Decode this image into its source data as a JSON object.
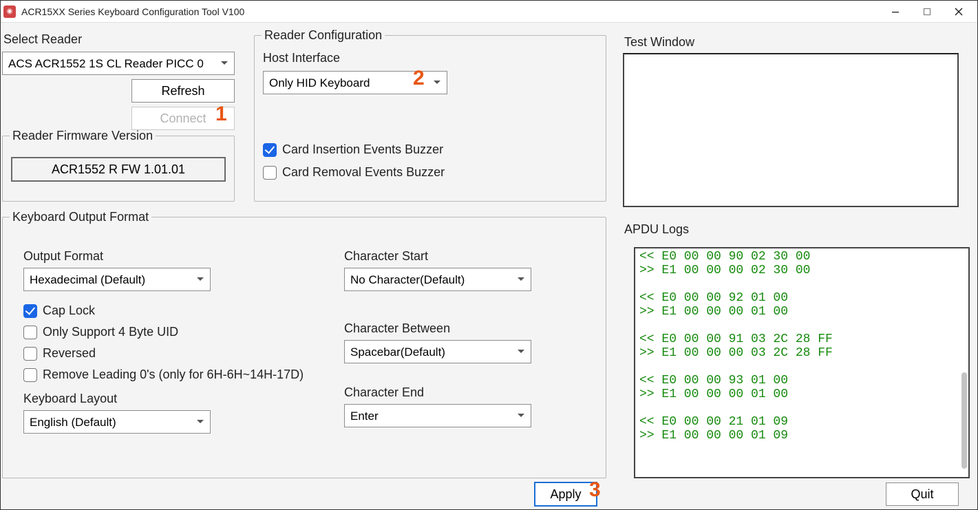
{
  "window": {
    "title": "ACR15XX Series Keyboard Configuration Tool V100"
  },
  "selectReader": {
    "label": "Select Reader",
    "value": "ACS ACR1552 1S CL Reader PICC 0",
    "refresh": "Refresh",
    "connect": "Connect"
  },
  "firmware": {
    "legend": "Reader Firmware Version",
    "value": "ACR1552 R FW 1.01.01"
  },
  "readerConfig": {
    "legend": "Reader Configuration",
    "hostInterfaceLabel": "Host Interface",
    "hostInterfaceValue": "Only HID Keyboard",
    "cardInsertion": "Card Insertion Events Buzzer",
    "cardRemoval": "Card Removal Events Buzzer"
  },
  "kof": {
    "legend": "Keyboard Output Format",
    "outputFormatLabel": "Output Format",
    "outputFormatValue": "Hexadecimal (Default)",
    "capLock": "Cap Lock",
    "only4byte": "Only Support 4 Byte UID",
    "reversed": "Reversed",
    "removeLeading": "Remove Leading 0's (only for 6H-6H~14H-17D)",
    "keyboardLayoutLabel": "Keyboard Layout",
    "keyboardLayoutValue": "English (Default)",
    "charStartLabel": "Character Start",
    "charStartValue": "No Character(Default)",
    "charBetweenLabel": "Character Between",
    "charBetweenValue": "Spacebar(Default)",
    "charEndLabel": "Character End",
    "charEndValue": "Enter"
  },
  "buttons": {
    "apply": "Apply",
    "quit": "Quit"
  },
  "testWindow": {
    "label": "Test Window",
    "value": ""
  },
  "apduLogs": {
    "label": "APDU Logs",
    "lines": [
      "<< E0 00 00 90 02 30 00",
      ">> E1 00 00 00 02 30 00",
      "",
      "<< E0 00 00 92 01 00",
      ">> E1 00 00 00 01 00",
      "",
      "<< E0 00 00 91 03 2C 28 FF",
      ">> E1 00 00 00 03 2C 28 FF",
      "",
      "<< E0 00 00 93 01 00",
      ">> E1 00 00 00 01 00",
      "",
      "<< E0 00 00 21 01 09",
      ">> E1 00 00 00 01 09"
    ]
  },
  "annotations": {
    "conn": "1",
    "host": "2",
    "apply": "3"
  }
}
